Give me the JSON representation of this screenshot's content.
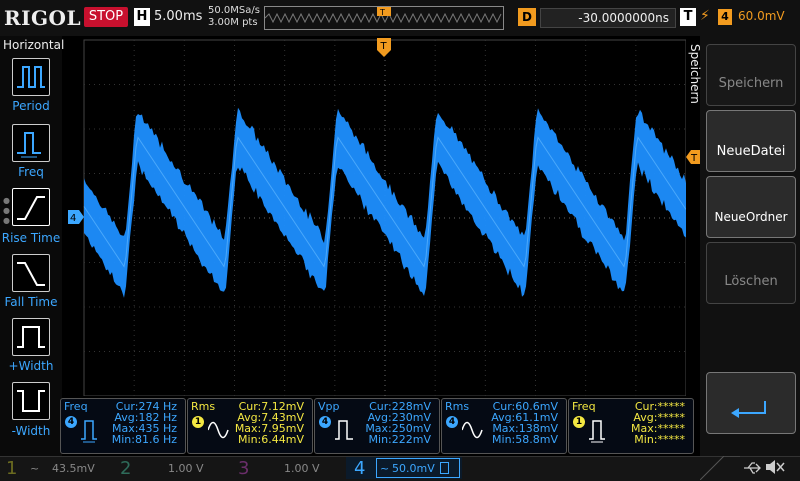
{
  "header": {
    "logo": "RIGOL",
    "run_state": "STOP",
    "h_key": "H",
    "timebase": "5.00ms",
    "sample_rate": "50.0MSa/s",
    "memory_depth": "3.00M pts",
    "delay_key": "D",
    "delay": "-30.0000000ns",
    "trig_key": "T",
    "trig_slope": "⚡",
    "trig_channel": "4",
    "trig_level": "60.0mV"
  },
  "left_menu": {
    "title": "Horizontal",
    "items": [
      {
        "label": "Period"
      },
      {
        "label": "Freq"
      },
      {
        "label": "Rise Time"
      },
      {
        "label": "Fall Time"
      },
      {
        "label": "+Width"
      },
      {
        "label": "-Width"
      }
    ]
  },
  "right_menu": {
    "title": "Speichern",
    "buttons": [
      {
        "label": "Speichern"
      },
      {
        "label": "NeueDatei"
      },
      {
        "label": "NeueOrdner"
      },
      {
        "label": "Löschen"
      }
    ]
  },
  "markers": {
    "trigger_top": "T",
    "channel_marker": "4",
    "trigger_level_marker": "T"
  },
  "measurements": [
    {
      "name": "Freq",
      "channel": "4",
      "color": "#3ca7ff",
      "cur": "Cur:274 Hz",
      "avg": "Avg:182 Hz",
      "max": "Max:435 Hz",
      "min": "Min:81.6 Hz"
    },
    {
      "name": "Rms",
      "channel": "1",
      "color": "#f4e842",
      "cur": "Cur:7.12mV",
      "avg": "Avg:7.43mV",
      "max": "Max:7.95mV",
      "min": "Min:6.44mV"
    },
    {
      "name": "Vpp",
      "channel": "4",
      "color": "#3ca7ff",
      "cur": "Cur:228mV",
      "avg": "Avg:230mV",
      "max": "Max:250mV",
      "min": "Min:222mV"
    },
    {
      "name": "Rms",
      "channel": "4",
      "color": "#3ca7ff",
      "cur": "Cur:60.6mV",
      "avg": "Avg:61.1mV",
      "max": "Max:138mV",
      "min": "Min:58.8mV"
    },
    {
      "name": "Freq",
      "channel": "1",
      "color": "#f4e842",
      "cur": "Cur:*****",
      "avg": "Avg:*****",
      "max": "Max:*****",
      "min": "Min:*****"
    }
  ],
  "channels": [
    {
      "num": "1",
      "coupling": "~",
      "scale": "43.5mV"
    },
    {
      "num": "2",
      "coupling": "",
      "scale": "1.00 V"
    },
    {
      "num": "3",
      "coupling": "",
      "scale": "1.00 V"
    },
    {
      "num": "4",
      "coupling": "~",
      "scale": "50.0mV"
    }
  ],
  "colors": {
    "ch4": "#1e90ff",
    "trigger": "#f29b1f",
    "ch1": "#f4e842",
    "stop": "#c8102e"
  }
}
